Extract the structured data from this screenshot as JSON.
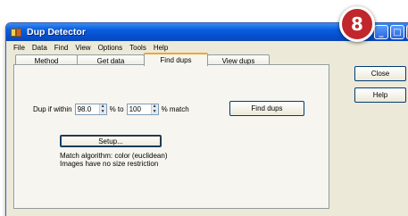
{
  "window": {
    "title": "Dup Detector",
    "controls": {
      "minimize": "_",
      "maximize": "□",
      "close": "X"
    }
  },
  "menu": [
    "File",
    "Data",
    "Find",
    "View",
    "Options",
    "Tools",
    "Help"
  ],
  "tabs": [
    "Method",
    "Get data",
    "Find dups",
    "View dups"
  ],
  "active_tab": "Find dups",
  "find": {
    "label_prefix": "Dup if within",
    "min_value": "98.0",
    "label_to": "% to",
    "max_value": "100",
    "label_suffix": "% match",
    "find_button": "Find dups"
  },
  "setup_button": "Setup...",
  "info_lines": [
    "Match algorithm: color (euclidean)",
    "Images have no size restriction"
  ],
  "side_buttons": {
    "close": "Close",
    "help": "Help"
  },
  "badge": {
    "number": "8",
    "color": "#c0262b"
  },
  "colors": {
    "title_blue": "#0550d0",
    "tab_highlight": "#f2a532",
    "panel_bg": "#ece9d8"
  }
}
